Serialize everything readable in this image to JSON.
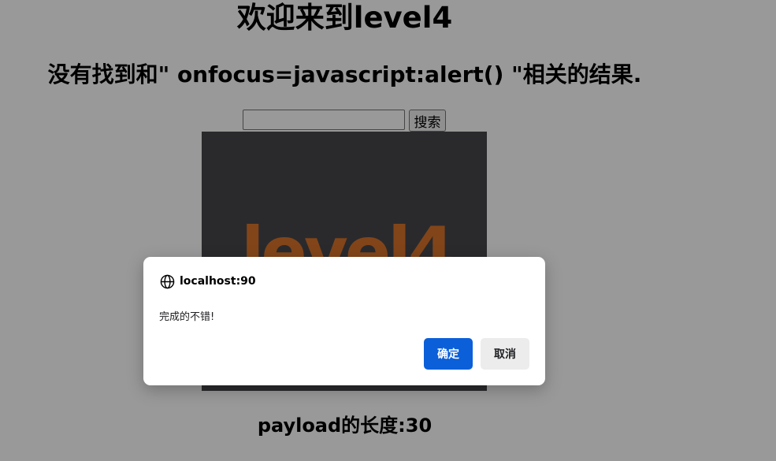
{
  "page": {
    "heading": "欢迎来到level4",
    "result_message": "没有找到和\" onfocus=javascript:alert() \"相关的结果.",
    "payload_length": "payload的长度:30"
  },
  "search": {
    "input_value": "",
    "button_label": "搜索"
  },
  "image": {
    "logo_text": "level4"
  },
  "dialog": {
    "origin": "localhost:90",
    "message": "完成的不错!",
    "ok_label": "确定",
    "cancel_label": "取消",
    "icon": "globe-icon"
  },
  "colors": {
    "ok_button": "#0b5fd9",
    "cancel_button": "#ececec",
    "logo_orange": "#d9732a",
    "image_background": "#46464c"
  }
}
